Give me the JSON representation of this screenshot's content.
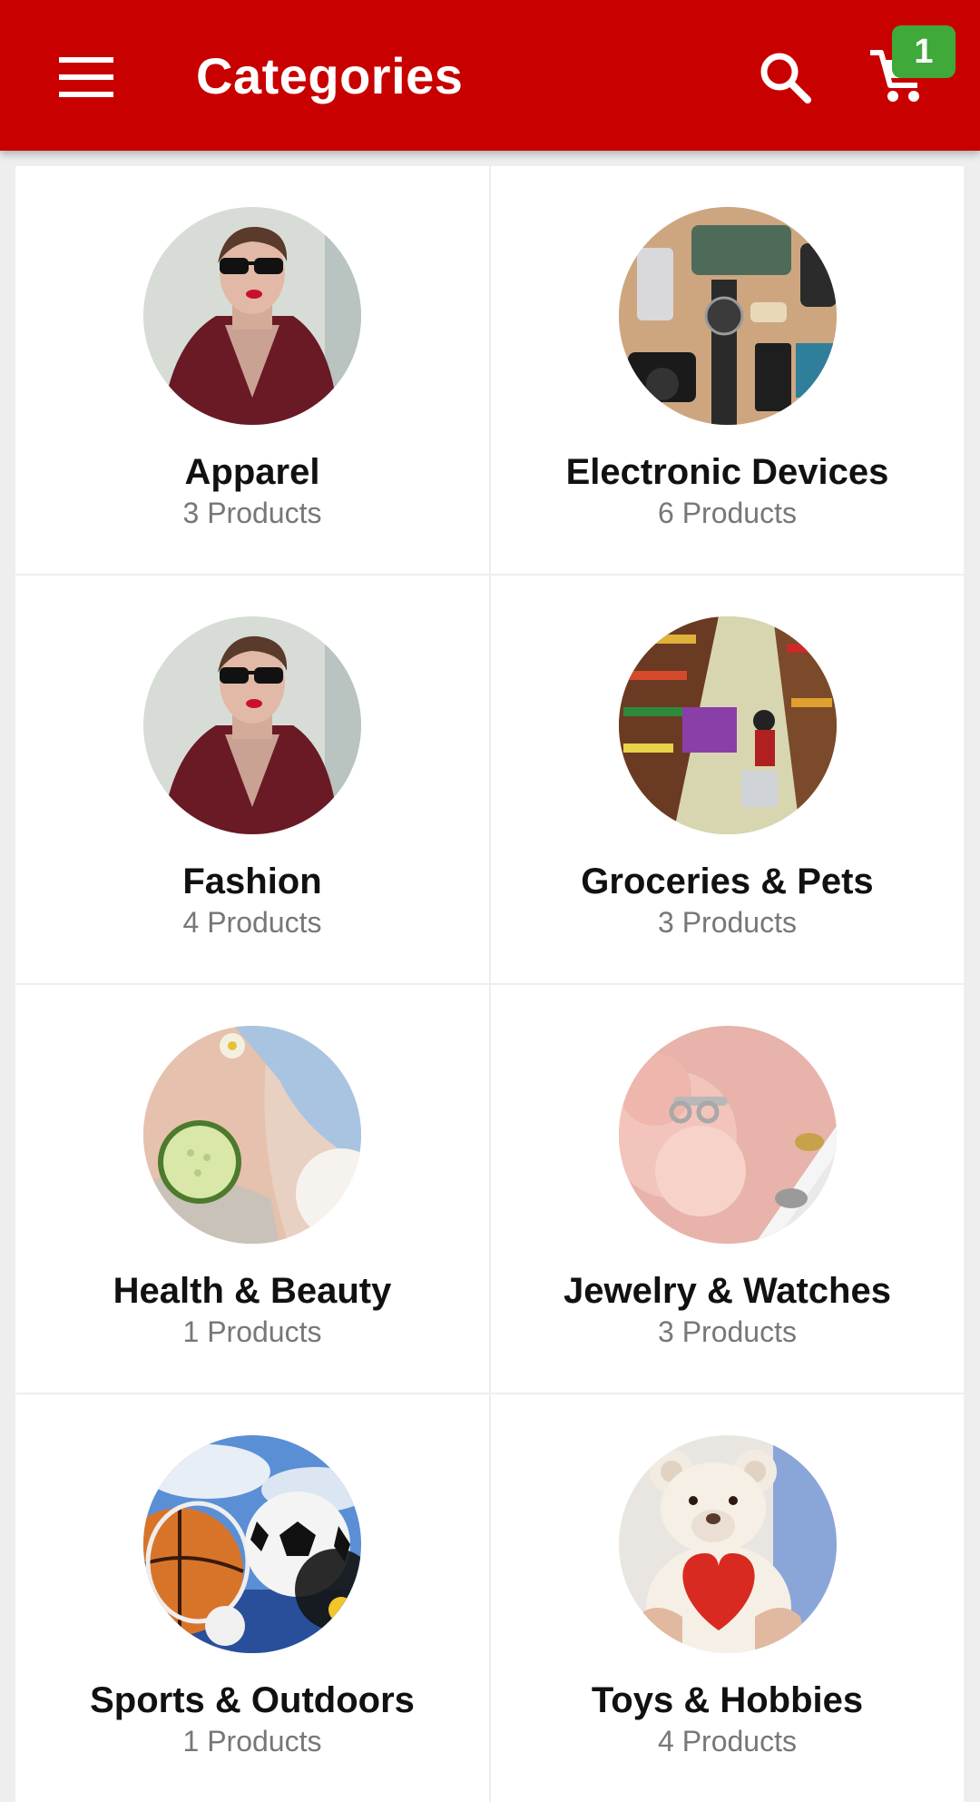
{
  "header": {
    "title": "Categories",
    "menu_icon": "hamburger-menu-icon",
    "search_icon": "search-icon",
    "cart_icon": "cart-icon",
    "cart_count": "1",
    "bar_color": "#c80000",
    "badge_color": "#3faa3a"
  },
  "categories": [
    {
      "name": "Apparel",
      "count": "3 Products",
      "image": "woman-in-sunglasses-photo"
    },
    {
      "name": "Electronic Devices",
      "count": "6 Products",
      "image": "gadgets-flatlay-photo"
    },
    {
      "name": "Fashion",
      "count": "4 Products",
      "image": "woman-in-sunglasses-photo"
    },
    {
      "name": "Groceries & Pets",
      "count": "3 Products",
      "image": "supermarket-aisle-photo"
    },
    {
      "name": "Health & Beauty",
      "count": "1 Products",
      "image": "spa-cucumber-photo"
    },
    {
      "name": "Jewelry & Watches",
      "count": "3 Products",
      "image": "rings-and-flower-photo"
    },
    {
      "name": "Sports & Outdoors",
      "count": "1 Products",
      "image": "sports-balls-photo"
    },
    {
      "name": "Toys & Hobbies",
      "count": "4 Products",
      "image": "teddy-bear-photo"
    }
  ]
}
